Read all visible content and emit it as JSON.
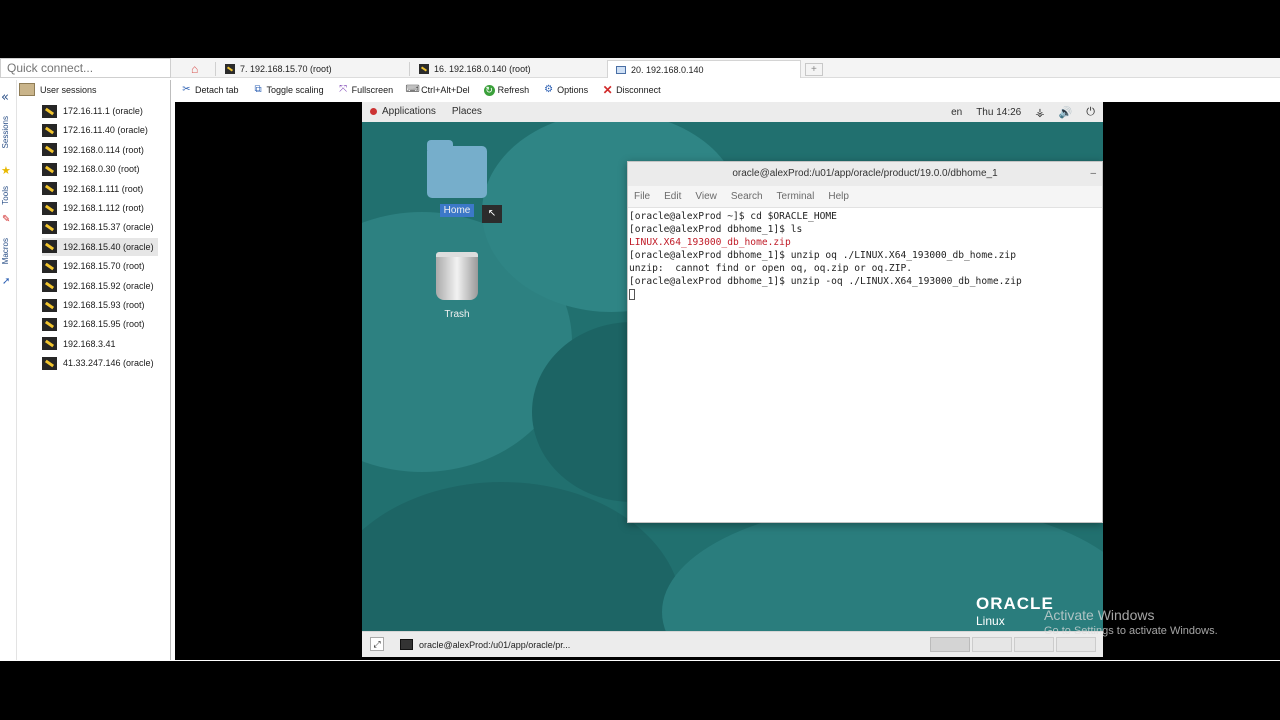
{
  "quick_connect": {
    "placeholder": "Quick connect..."
  },
  "tabs": [
    {
      "label": "7. 192.168.15.70 (root)"
    },
    {
      "label": "16. 192.168.0.140 (root)"
    },
    {
      "label": "20. 192.168.0.140"
    }
  ],
  "toolbar": {
    "detach": "Detach tab",
    "scaling": "Toggle scaling",
    "fullscreen": "Fullscreen",
    "cad": "Ctrl+Alt+Del",
    "refresh": "Refresh",
    "options": "Options",
    "disconnect": "Disconnect"
  },
  "side_strip": {
    "sessions": "Sessions",
    "tools": "Tools",
    "macros": "Macros"
  },
  "sidebar": {
    "root": "User sessions",
    "items": [
      "172.16.11.1 (oracle)",
      "172.16.11.40 (oracle)",
      "192.168.0.114 (root)",
      "192.168.0.30 (root)",
      "192.168.1.111 (root)",
      "192.168.1.112 (root)",
      "192.168.15.37 (oracle)",
      "192.168.15.40 (oracle)",
      "192.168.15.70 (root)",
      "192.168.15.92 (oracle)",
      "192.168.15.93 (root)",
      "192.168.15.95 (root)",
      "192.168.3.41",
      "41.33.247.146 (oracle)"
    ],
    "selected_index": 7
  },
  "gnome": {
    "applications": "Applications",
    "places": "Places",
    "lang": "en",
    "clock": "Thu 14:26"
  },
  "desktop_icons": {
    "home": "Home",
    "trash": "Trash"
  },
  "terminal": {
    "title": "oracle@alexProd:/u01/app/oracle/product/19.0.0/dbhome_1",
    "close": "–",
    "menu": [
      "File",
      "Edit",
      "View",
      "Search",
      "Terminal",
      "Help"
    ],
    "lines": [
      "[oracle@alexProd ~]$ cd $ORACLE_HOME",
      "[oracle@alexProd dbhome_1]$ ls",
      "LINUX.X64_193000_db_home.zip",
      "[oracle@alexProd dbhome_1]$ unzip oq ./LINUX.X64_193000_db_home.zip",
      "unzip:  cannot find or open oq, oq.zip or oq.ZIP.",
      "[oracle@alexProd dbhome_1]$ unzip -oq ./LINUX.X64_193000_db_home.zip"
    ],
    "red_line_index": 2
  },
  "taskbar": {
    "task": "oracle@alexProd:/u01/app/oracle/pr..."
  },
  "branding": {
    "oracle": "ORACLE",
    "linux": "Linux"
  },
  "watermark": {
    "title": "Activate Windows",
    "subtitle": "Go to Settings to activate Windows."
  },
  "colors": {
    "desktop": "#21706f",
    "accent": "#2a4f87",
    "terminal_red": "#c01c28"
  }
}
